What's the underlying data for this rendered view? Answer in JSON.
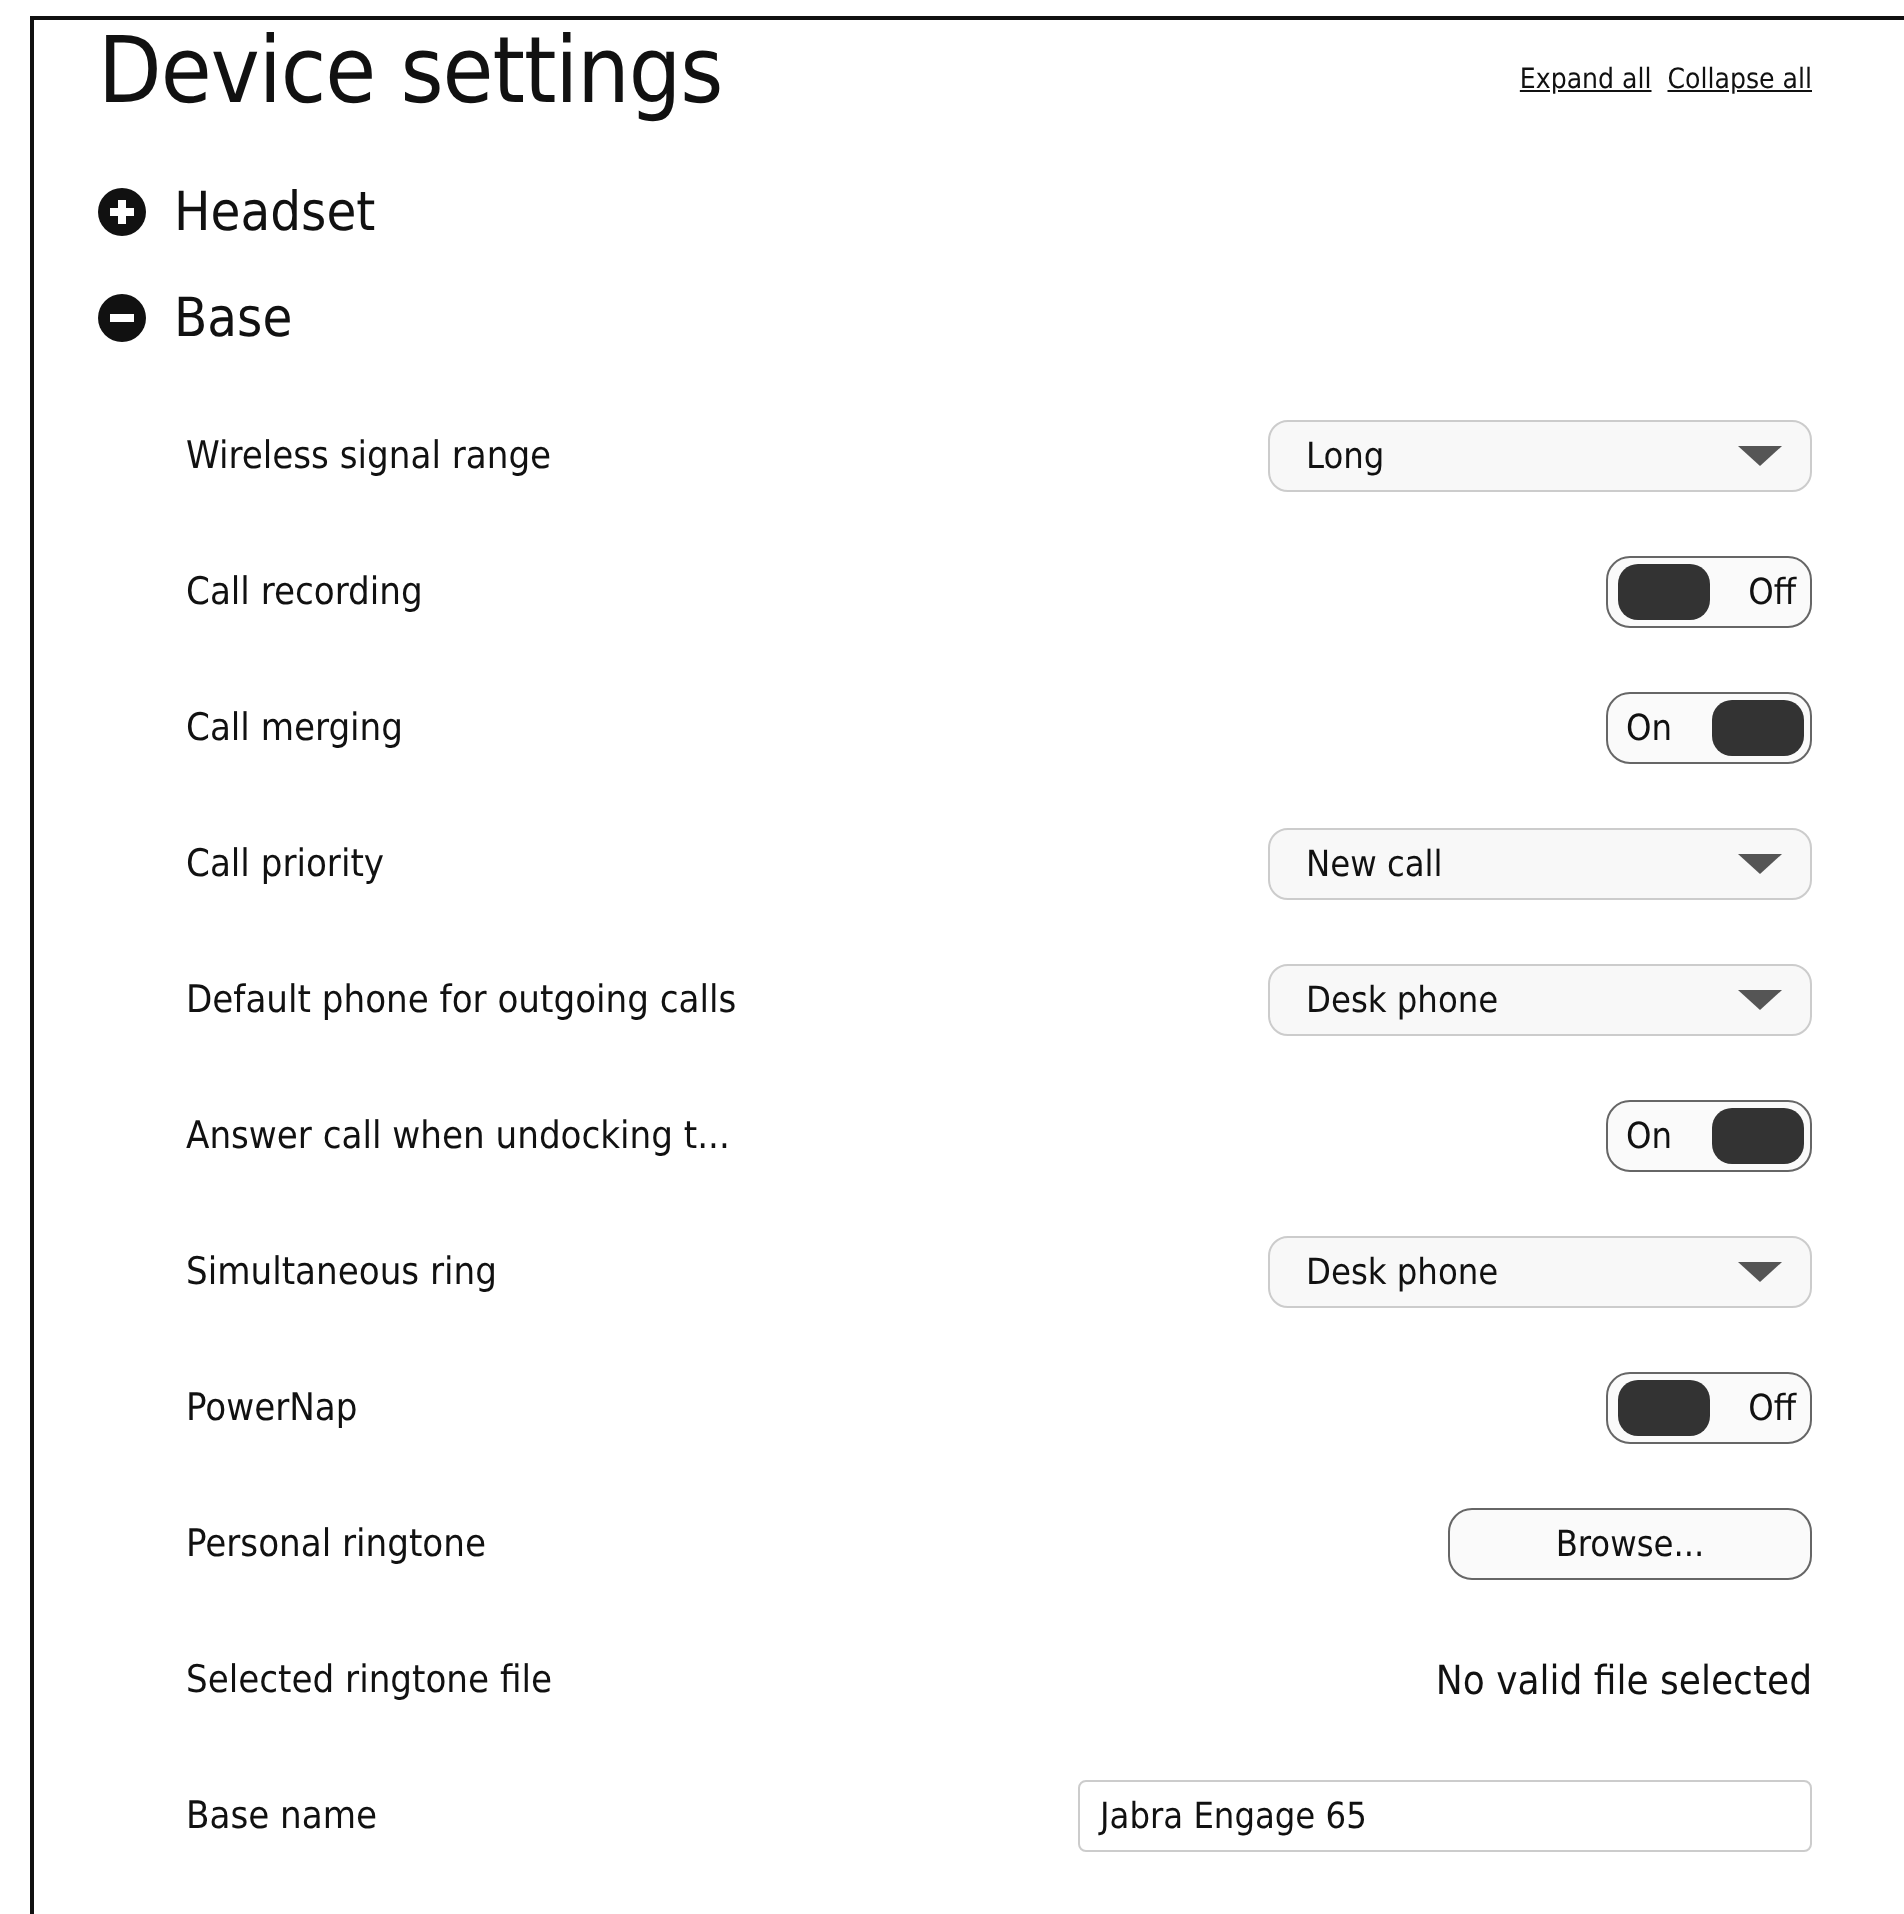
{
  "title": "Device settings",
  "links": [
    "Expand all",
    "Collapse all"
  ],
  "sections": [
    {
      "title": "Headset",
      "expanded": false
    },
    {
      "title": "Base",
      "expanded": true,
      "rows": [
        {
          "kind": "select",
          "label": "Wireless signal range",
          "value": "Long"
        },
        {
          "kind": "toggle",
          "label": "Call recording",
          "on": false,
          "text": "Off"
        },
        {
          "kind": "toggle",
          "label": "Call merging",
          "on": true,
          "text": "On"
        },
        {
          "kind": "select",
          "label": "Call priority",
          "value": "New call"
        },
        {
          "kind": "select",
          "label": "Default phone for outgoing calls",
          "value": "Desk phone"
        },
        {
          "kind": "toggle",
          "label": "Answer call when undocking t...",
          "on": true,
          "text": "On"
        },
        {
          "kind": "select",
          "label": "Simultaneous ring",
          "value": "Desk phone"
        },
        {
          "kind": "toggle",
          "label": "PowerNap",
          "on": false,
          "text": "Off"
        },
        {
          "kind": "button",
          "label": "Personal ringtone",
          "text": "Browse..."
        },
        {
          "kind": "text",
          "label": "Selected ringtone file",
          "text": "No valid file selected"
        },
        {
          "kind": "input",
          "label": "Base name",
          "value": "Jabra Engage 65"
        }
      ]
    }
  ]
}
